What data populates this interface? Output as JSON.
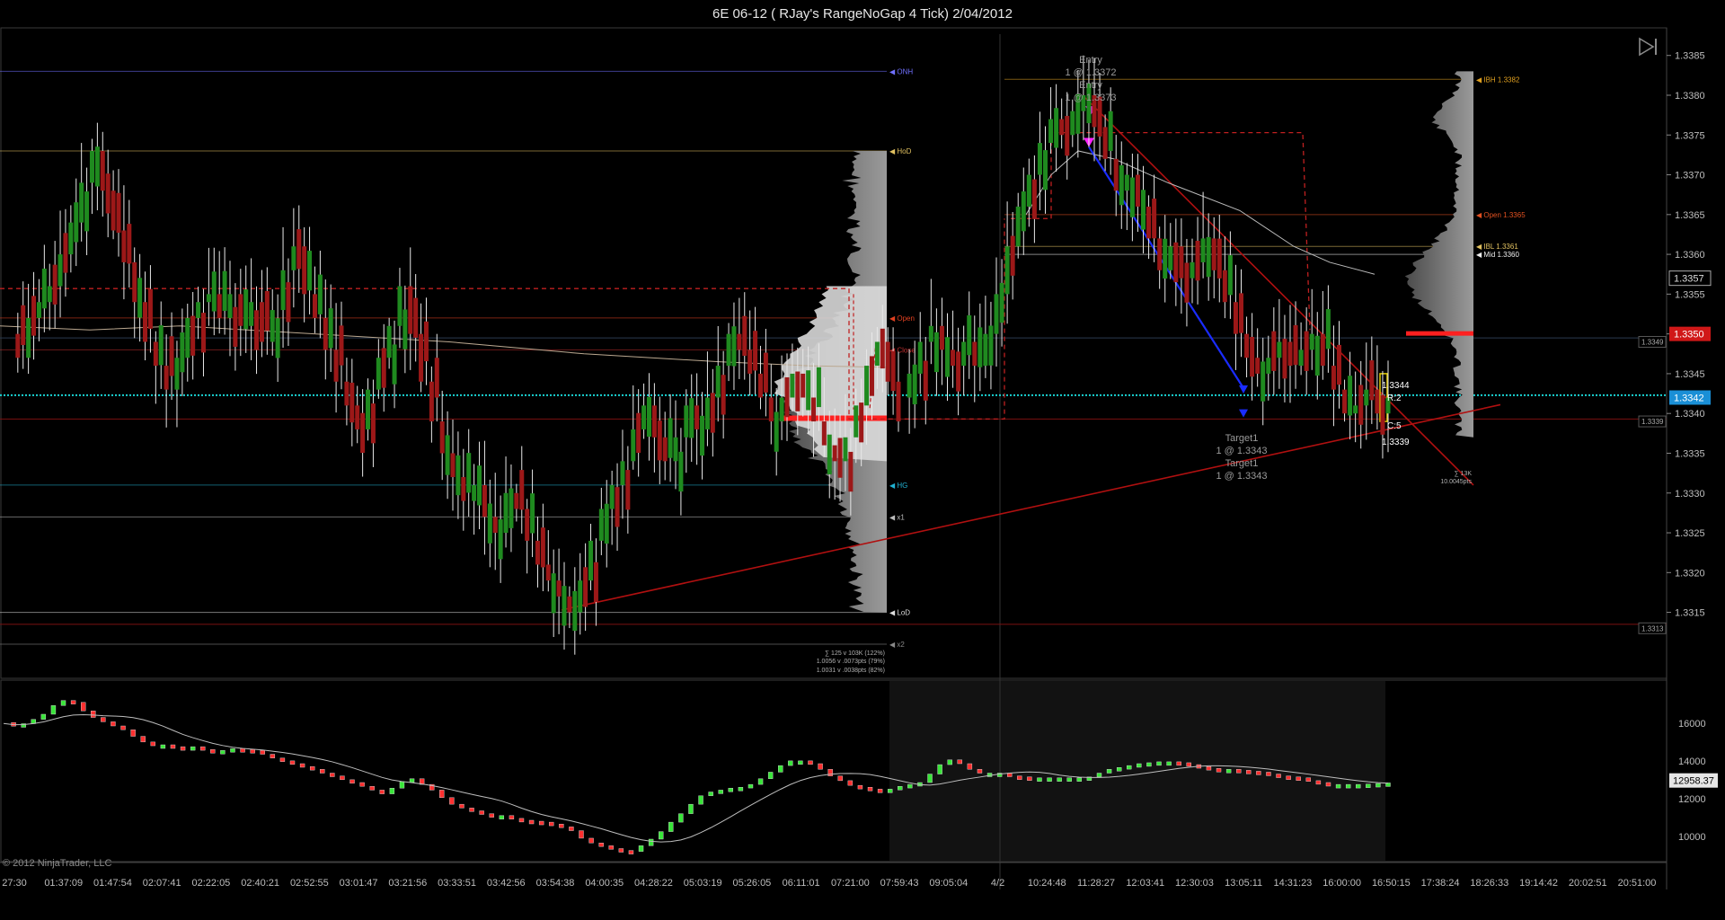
{
  "window": {
    "title": "6E 06-12 ( RJay's RangeNoGap  4 Tick)  2/04/2012",
    "copyright": "© 2012 NinjaTrader, LLC"
  },
  "colors": {
    "background": "#000000",
    "up_candle": "#1f8a1f",
    "down_candle": "#9c1818",
    "trendline": "#b01010",
    "current_price": "#1a8fd6",
    "cyan_line": "#19d3d3",
    "profile": "#c8c8c8",
    "volume_up": "#39e639",
    "volume_down": "#ff3030"
  },
  "icons": [
    "skip-to-end-icon"
  ],
  "chart_data": [
    {
      "type": "candlestick",
      "panel": "price",
      "ylim": [
        1.3311,
        1.3387
      ],
      "y_ticks": [
        "1.3385",
        "1.3380",
        "1.3375",
        "1.3370",
        "1.3365",
        "1.3360",
        "1.3355",
        "1.3350",
        "1.3345",
        "1.3340",
        "1.3335",
        "1.3330",
        "1.3325",
        "1.3320",
        "1.3315"
      ],
      "path_session1": [
        1.335,
        1.3347,
        1.3352,
        1.3354,
        1.3356,
        1.336,
        1.3364,
        1.3369,
        1.3373,
        1.3368,
        1.3363,
        1.3359,
        1.3354,
        1.3349,
        1.3346,
        1.3343,
        1.3347,
        1.3352,
        1.3354,
        1.3355,
        1.3352,
        1.3355,
        1.3351,
        1.3354,
        1.3349,
        1.3353,
        1.3358,
        1.3361,
        1.3355,
        1.3352,
        1.3348,
        1.3344,
        1.3341,
        1.3338,
        1.3343,
        1.3347,
        1.3351,
        1.3356,
        1.335,
        1.3344,
        1.3339,
        1.3335,
        1.3332,
        1.3329,
        1.3331,
        1.3327,
        1.3325,
        1.333,
        1.3328,
        1.3324,
        1.3321,
        1.3319,
        1.3317,
        1.3315,
        1.3319,
        1.3324,
        1.3328,
        1.3331,
        1.3334,
        1.3338,
        1.3341,
        1.3337,
        1.3334,
        1.3337,
        1.3341,
        1.3338,
        1.3342,
        1.3346,
        1.335,
        1.3348,
        1.3345,
        1.3342,
        1.3339,
        1.3342,
        1.3345,
        1.3342,
        1.3339,
        1.3336,
        1.3334,
        1.3337,
        1.3341,
        1.3346,
        1.3349,
        1.3344,
        1.3339
      ],
      "path_session2": [
        1.3342,
        1.3345,
        1.3349,
        1.3351,
        1.3348,
        1.3346,
        1.3349,
        1.3346,
        1.335,
        1.3355,
        1.3361,
        1.3366,
        1.337,
        1.3374,
        1.3377,
        1.3375,
        1.3378,
        1.338,
        1.3376,
        1.3372,
        1.3368,
        1.337,
        1.3366,
        1.3362,
        1.3358,
        1.3361,
        1.3357,
        1.3359,
        1.3362,
        1.3358,
        1.3354,
        1.335,
        1.3347,
        1.3345,
        1.3347,
        1.3349,
        1.3346,
        1.3348,
        1.335,
        1.3346,
        1.3343,
        1.334,
        1.3341,
        1.3343,
        1.334,
        1.3342
      ],
      "levels": [
        {
          "label": "ONH",
          "value": 1.3383,
          "color": "#7070ff"
        },
        {
          "label": "HoD",
          "value": 1.3373,
          "color": "#e0c060"
        },
        {
          "label": "Open",
          "value": 1.3352,
          "color": "#e04020"
        },
        {
          "label": "Close",
          "value": 1.3348,
          "color": "#c03030"
        },
        {
          "label": "HG",
          "value": 1.3331,
          "color": "#20b0d0"
        },
        {
          "label": "x1",
          "value": 1.3327,
          "color": "#bbbbbb"
        },
        {
          "label": "LoD",
          "value": 1.3315,
          "color": "#dddddd"
        },
        {
          "label": "x2",
          "value": 1.3311,
          "color": "#888888"
        },
        {
          "label": "IBH 1.3382",
          "value": 1.3382,
          "color": "#e0a020"
        },
        {
          "label": "Open 1.3365",
          "value": 1.3365,
          "color": "#e05020"
        },
        {
          "label": "IBL 1.3361",
          "value": 1.3361,
          "color": "#e0c060"
        },
        {
          "label": "Mid 1.3360",
          "value": 1.336,
          "color": "#eeeeee"
        }
      ],
      "price_boxes": [
        {
          "label": "1.3357",
          "value": 1.3357,
          "style": "outline"
        },
        {
          "label": "1.3350",
          "value": 1.335,
          "style": "red"
        },
        {
          "label": "1.3342",
          "value": 1.3342,
          "style": "blue"
        },
        {
          "label": "1.3349",
          "value": 1.3349,
          "style": "small"
        },
        {
          "label": "1.3339",
          "value": 1.3339,
          "style": "small"
        },
        {
          "label": "1.3313",
          "value": 1.3313,
          "style": "small"
        }
      ],
      "annotations": {
        "entry": [
          "Entry",
          "1 @ 1.3372",
          "Entry",
          "1 @ 1.3373"
        ],
        "target": [
          "Target1",
          "1 @ 1.3343",
          "Target1",
          "1 @ 1.3343"
        ],
        "bar_info": [
          "1.3344",
          "R:2",
          "C:5",
          "1.3339"
        ],
        "profile_stats_left": [
          "∑ 125 v 103K (122%)",
          "1.0056 v .0073pts (79%)",
          "1.0031 v .0038pts (82%)"
        ],
        "profile_stats_right": [
          "∑ 13K",
          "10.0045pts"
        ]
      }
    },
    {
      "type": "candlestick",
      "panel": "indicator",
      "ylim": [
        8800,
        17800
      ],
      "y_ticks": [
        "16000",
        "14000",
        "12000",
        "10000"
      ],
      "current_value": "12958.37",
      "path": [
        15980,
        15850,
        15920,
        16150,
        16420,
        16880,
        17150,
        17050,
        16600,
        16250,
        16020,
        15800,
        15600,
        15250,
        14950,
        14750,
        14800,
        14700,
        14650,
        14700,
        14550,
        14450,
        14500,
        14600,
        14550,
        14500,
        14300,
        14100,
        13950,
        13800,
        13650,
        13500,
        13300,
        13150,
        12950,
        12800,
        12600,
        12400,
        12200,
        12500,
        12850,
        13000,
        12700,
        12400,
        12000,
        11650,
        11450,
        11300,
        11150,
        11000,
        11050,
        10900,
        10800,
        10750,
        10700,
        10600,
        10450,
        10250,
        9850,
        9600,
        9450,
        9300,
        9200,
        9150,
        9450,
        9800,
        10200,
        10700,
        11150,
        11650,
        12100,
        12300,
        12400,
        12500,
        12550,
        12700,
        13000,
        13350,
        13700,
        13950,
        13950,
        13800,
        13500,
        13150,
        12900,
        12650,
        12550,
        12450,
        12350,
        12450,
        12600,
        12700,
        12800,
        13250,
        13750,
        14000,
        13800,
        13500,
        13300,
        13300,
        13300,
        13150,
        13100,
        13050,
        13050,
        13050,
        13050,
        13050,
        13050,
        13100,
        13300,
        13500,
        13600,
        13700,
        13800,
        13850,
        13900,
        13900,
        13850,
        13750,
        13650,
        13550,
        13500,
        13500,
        13450,
        13400,
        13350,
        13250,
        13150,
        13100,
        13050,
        12900,
        12800,
        12700,
        12700,
        12700,
        12700,
        12720,
        12750,
        12780
      ]
    }
  ],
  "x_axis": {
    "labels": [
      "27:30",
      "01:37:09",
      "01:47:54",
      "02:07:41",
      "02:22:05",
      "02:40:21",
      "02:52:55",
      "03:01:47",
      "03:21:56",
      "03:33:51",
      "03:42:56",
      "03:54:38",
      "04:00:35",
      "04:28:22",
      "05:03:19",
      "05:26:05",
      "06:11:01",
      "07:21:00",
      "07:59:43",
      "09:05:04",
      "4/2",
      "10:24:48",
      "11:28:27",
      "12:03:41",
      "12:30:03",
      "13:05:11",
      "14:31:23",
      "16:00:00",
      "16:50:15",
      "17:38:24",
      "18:26:33",
      "19:14:42",
      "20:02:51",
      "20:51:00"
    ]
  }
}
